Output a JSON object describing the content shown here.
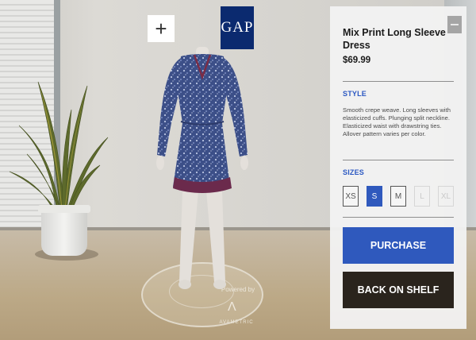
{
  "overlay": {
    "add_icon": "plus-icon",
    "brand_logo_text": "GAP"
  },
  "display": {
    "powered_by": "Powered by",
    "provider": "AVAMETRIC"
  },
  "product": {
    "title": "Mix Print Long Sleeve Dress",
    "price": "$69.99",
    "style_heading": "STYLE",
    "description": "Smooth crepe weave. Long sleeves with elasticized cuffs. Plunging split neckline. Elasticized waist with drawstring ties. Allover pattern varies per color.",
    "sizes_heading": "SIZES",
    "sizes": [
      {
        "label": "XS",
        "state": "available"
      },
      {
        "label": "S",
        "state": "selected"
      },
      {
        "label": "M",
        "state": "available"
      },
      {
        "label": "L",
        "state": "unavailable"
      },
      {
        "label": "XL",
        "state": "unavailable"
      }
    ],
    "purchase_label": "PURCHASE",
    "back_label": "BACK ON SHELF"
  },
  "colors": {
    "accent_blue": "#2f59bd",
    "brand_navy": "#0b2a6f",
    "dark_button": "#2a241d"
  }
}
